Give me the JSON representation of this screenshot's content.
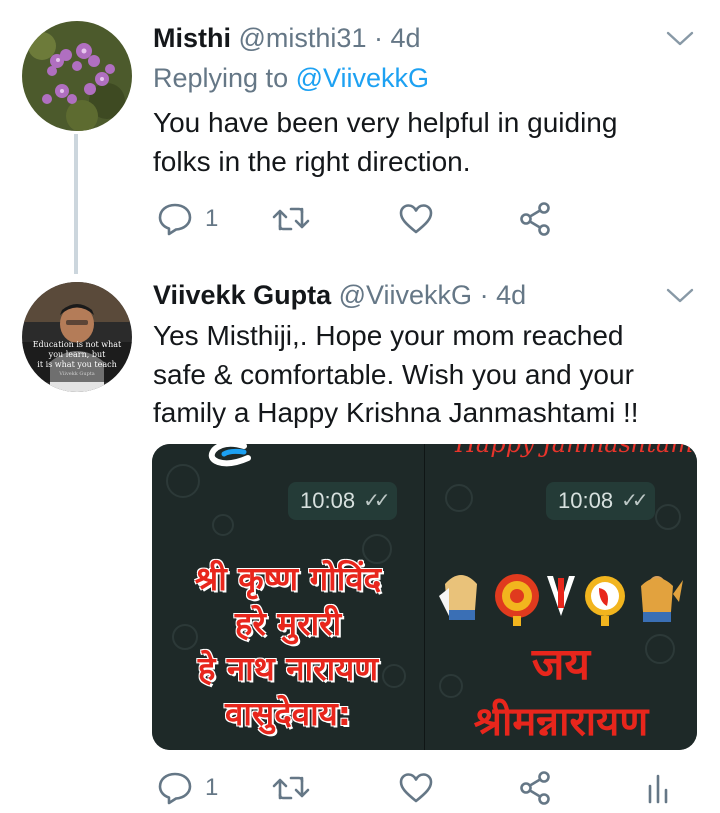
{
  "tweets": [
    {
      "name": "Misthi",
      "handle": "@misthi31",
      "separator": "·",
      "time": "4d",
      "replying_label": "Replying to",
      "replying_to": "@ViivekkG",
      "body_lines": [
        "You have been very helpful in guiding",
        "folks in the right direction."
      ],
      "avatar_icon": "flower-photo",
      "actions": {
        "reply_count": "1",
        "retweet_count": "",
        "like_count": ""
      }
    },
    {
      "name": "Viivekk Gupta",
      "handle": "@ViivekkG",
      "separator": "·",
      "time": "4d",
      "body_lines": [
        "Yes Misthiji,. Hope your mom reached",
        "safe & comfortable.  Wish you and your",
        "family a Happy Krishna Janmashtami !!"
      ],
      "avatar_text": [
        "Education is not what",
        "you learn, but",
        "it is what you teach",
        "Viivekk Gupta"
      ],
      "media": {
        "left": {
          "time": "10:08",
          "lines": [
            "श्री कृष्ण गोविंद",
            "हरे मुरारी",
            "हे नाथ नारायण",
            "वासुदेवाय:"
          ]
        },
        "right": {
          "header": "Happy Janmashtami",
          "time": "10:08",
          "lines": [
            "जय",
            "श्रीमन्नारायण"
          ]
        }
      },
      "actions": {
        "reply_count": "1",
        "retweet_count": "",
        "like_count": ""
      }
    }
  ],
  "colors": {
    "text": "#14171a",
    "secondary": "#657786",
    "link": "#1da1f2",
    "thread_line": "#ccd6dd",
    "devanagari_red": "#e8261c"
  },
  "icons": [
    "chevron-down-icon",
    "reply-icon",
    "retweet-icon",
    "like-icon",
    "share-icon",
    "analytics-icon"
  ]
}
